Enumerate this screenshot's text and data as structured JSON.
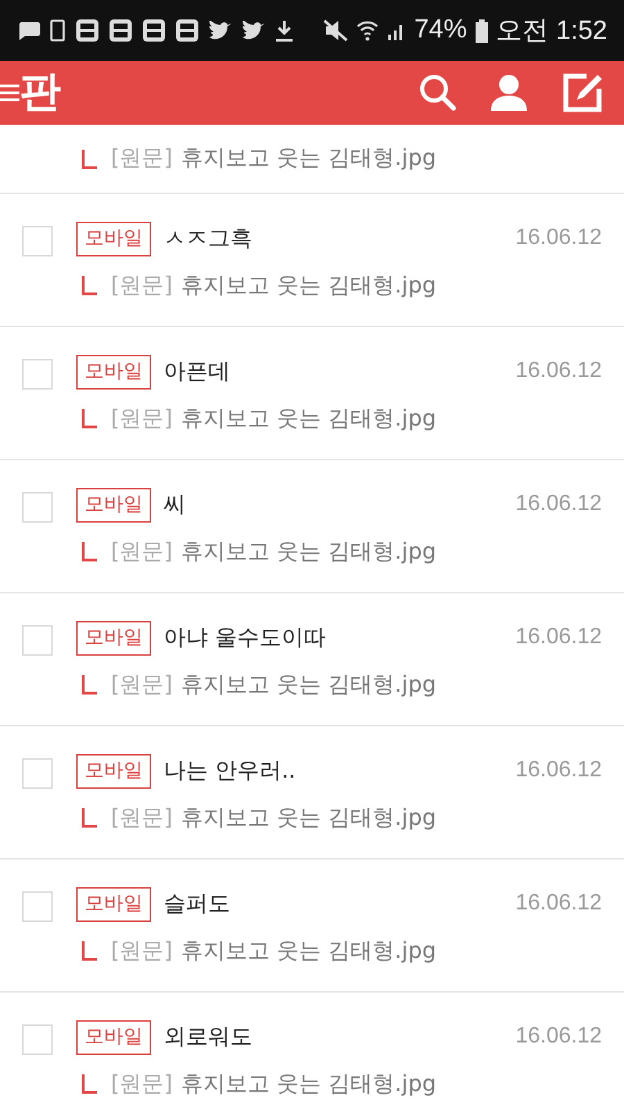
{
  "status_bar": {
    "battery": "74%",
    "time": "오전 1:52"
  },
  "header": {
    "logo": "판"
  },
  "partial_row": {
    "source_prefix": "[원문]",
    "source_title": "휴지보고 웃는 김태형.jpg"
  },
  "posts": [
    {
      "checked": false,
      "tag": "모바일",
      "title": "ㅅㅈ그흑",
      "date": "16.06.12",
      "source_prefix": "[원문]",
      "source_title": "휴지보고 웃는 김태형.jpg"
    },
    {
      "checked": false,
      "tag": "모바일",
      "title": "아픈데",
      "date": "16.06.12",
      "source_prefix": "[원문]",
      "source_title": "휴지보고 웃는 김태형.jpg"
    },
    {
      "checked": false,
      "tag": "모바일",
      "title": "씨",
      "date": "16.06.12",
      "source_prefix": "[원문]",
      "source_title": "휴지보고 웃는 김태형.jpg"
    },
    {
      "checked": false,
      "tag": "모바일",
      "title": "아냐 울수도이따",
      "date": "16.06.12",
      "source_prefix": "[원문]",
      "source_title": "휴지보고 웃는 김태형.jpg"
    },
    {
      "checked": false,
      "tag": "모바일",
      "title": "나는 안우러..",
      "date": "16.06.12",
      "source_prefix": "[원문]",
      "source_title": "휴지보고 웃는 김태형.jpg"
    },
    {
      "checked": false,
      "tag": "모바일",
      "title": "슬퍼도",
      "date": "16.06.12",
      "source_prefix": "[원문]",
      "source_title": "휴지보고 웃는 김태형.jpg"
    },
    {
      "checked": false,
      "tag": "모바일",
      "title": "외로워도",
      "date": "16.06.12",
      "source_prefix": "[원문]",
      "source_title": "휴지보고 웃는 김태형.jpg"
    }
  ]
}
